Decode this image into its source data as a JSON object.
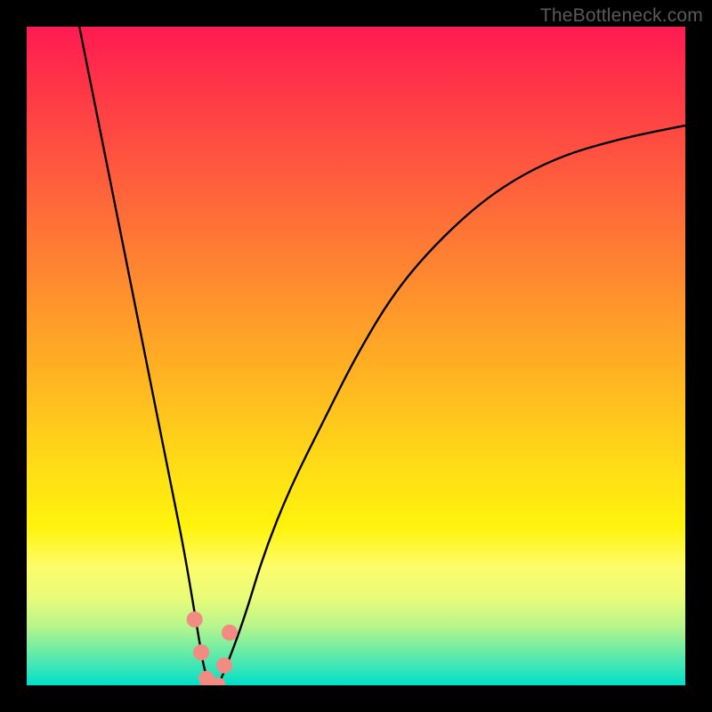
{
  "watermark": "TheBottleneck.com",
  "chart_data": {
    "type": "line",
    "title": "",
    "xlabel": "",
    "ylabel": "",
    "xlim": [
      0,
      100
    ],
    "ylim": [
      0,
      100
    ],
    "series": [
      {
        "name": "bottleneck-curve",
        "x": [
          8,
          10,
          12,
          14,
          16,
          18,
          20,
          22,
          24,
          26,
          27,
          28,
          29,
          30,
          33,
          36,
          40,
          45,
          50,
          56,
          63,
          71,
          80,
          90,
          100
        ],
        "y": [
          100,
          90,
          80,
          70,
          60,
          50,
          40,
          30,
          20,
          8,
          2,
          0,
          0,
          2,
          10,
          20,
          30,
          40,
          50,
          60,
          68,
          75,
          80,
          83,
          85
        ]
      },
      {
        "name": "minimum-markers",
        "x": [
          25.5,
          26.5,
          27.3,
          28.0,
          29.0,
          30.0,
          30.8
        ],
        "y": [
          10,
          5,
          1,
          0,
          0,
          3,
          8
        ]
      }
    ],
    "colors": {
      "curve": "#000000",
      "markers": "#f28b82",
      "gradient_top": "#ff1a52",
      "gradient_bottom": "#00e0c8"
    }
  }
}
